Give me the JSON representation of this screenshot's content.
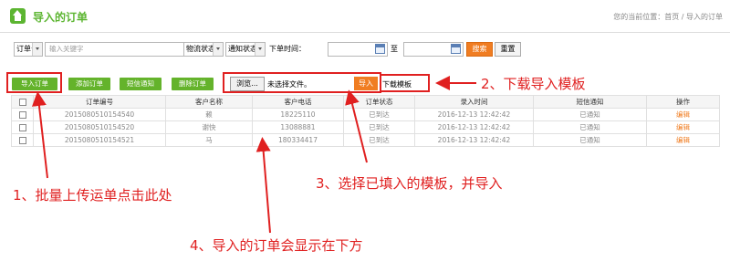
{
  "header": {
    "title": "导入的订单",
    "breadcrumb": "您的当前位置：首页 / 导入的订单"
  },
  "search": {
    "field_select": "订单号",
    "keyword_placeholder": "输入关键字",
    "logistics_select": "物流状态",
    "notify_select": "通知状态",
    "time_label": "下单时间：",
    "to_label": "至",
    "search_button": "搜索",
    "reset_button": "重置"
  },
  "toolbar": {
    "import_orders": "导入订单",
    "add_order": "添加订单",
    "sms_notify": "短信通知",
    "delete_order": "删除订单",
    "browse_button": "浏览...",
    "no_file": "未选择文件。",
    "import_button": "导入",
    "download_template": "下载模板"
  },
  "table": {
    "columns": [
      "订单编号",
      "客户名称",
      "客户电话",
      "订单状态",
      "录入时间",
      "短信通知",
      "操作"
    ],
    "rows": [
      {
        "order_no": "2015080510154540",
        "customer": "赖",
        "phone": "18225110",
        "status": "已到达",
        "time": "2016-12-13 12:42:42",
        "sms": "已通知",
        "op": "编辑"
      },
      {
        "order_no": "2015080510154520",
        "customer": "谢快",
        "phone": "13088881",
        "status": "已到达",
        "time": "2016-12-13 12:42:42",
        "sms": "已通知",
        "op": "编辑"
      },
      {
        "order_no": "2015080510154521",
        "customer": "马",
        "phone": "180334417",
        "status": "已到达",
        "time": "2016-12-13 12:42:42",
        "sms": "已通知",
        "op": "编辑"
      }
    ]
  },
  "annotations": {
    "a1": "1、批量上传运单点击此处",
    "a2": "2、下载导入模板",
    "a3": "3、选择已填入的模板，并导入",
    "a4": "4、导入的订单会显示在下方"
  },
  "colors": {
    "brand_green": "#5cb531",
    "accent_orange": "#f07d22",
    "annotation_red": "#e02020"
  }
}
